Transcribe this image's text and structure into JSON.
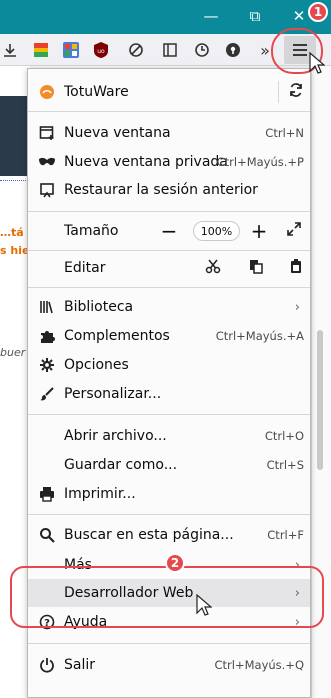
{
  "window": {
    "min_glyph": "—",
    "restore_glyph": "⧉",
    "close_glyph": "✕"
  },
  "background": {
    "line1": "…tá",
    "line2": "s hie",
    "line3": "buer"
  },
  "menu": {
    "account": {
      "label": "TotuWare"
    },
    "new_window": {
      "label": "Nueva ventana",
      "shortcut": "Ctrl+N"
    },
    "new_private": {
      "label": "Nueva ventana privada",
      "shortcut": "Ctrl+Mayús.+P"
    },
    "restore_session": {
      "label": "Restaurar la sesión anterior"
    },
    "zoom": {
      "label": "Tamaño",
      "value": "100%",
      "minus": "−",
      "plus": "+"
    },
    "edit": {
      "label": "Editar"
    },
    "library": {
      "label": "Biblioteca"
    },
    "addons": {
      "label": "Complementos",
      "shortcut": "Ctrl+Mayús.+A"
    },
    "options": {
      "label": "Opciones"
    },
    "customize": {
      "label": "Personalizar..."
    },
    "open_file": {
      "label": "Abrir archivo...",
      "shortcut": "Ctrl+O"
    },
    "save_as": {
      "label": "Guardar como...",
      "shortcut": "Ctrl+S"
    },
    "print": {
      "label": "Imprimir..."
    },
    "find": {
      "label": "Buscar en esta página...",
      "shortcut": "Ctrl+F"
    },
    "more": {
      "label": "Más"
    },
    "web_developer": {
      "label": "Desarrollador Web"
    },
    "help": {
      "label": "Ayuda"
    },
    "quit": {
      "label": "Salir",
      "shortcut": "Ctrl+Mayús.+Q"
    }
  },
  "annotations": {
    "badge1": "1",
    "badge2": "2"
  },
  "colors": {
    "titlebar": "#0a8a9a",
    "annotation": "#e5484d",
    "hover": "#e5e5e7"
  }
}
